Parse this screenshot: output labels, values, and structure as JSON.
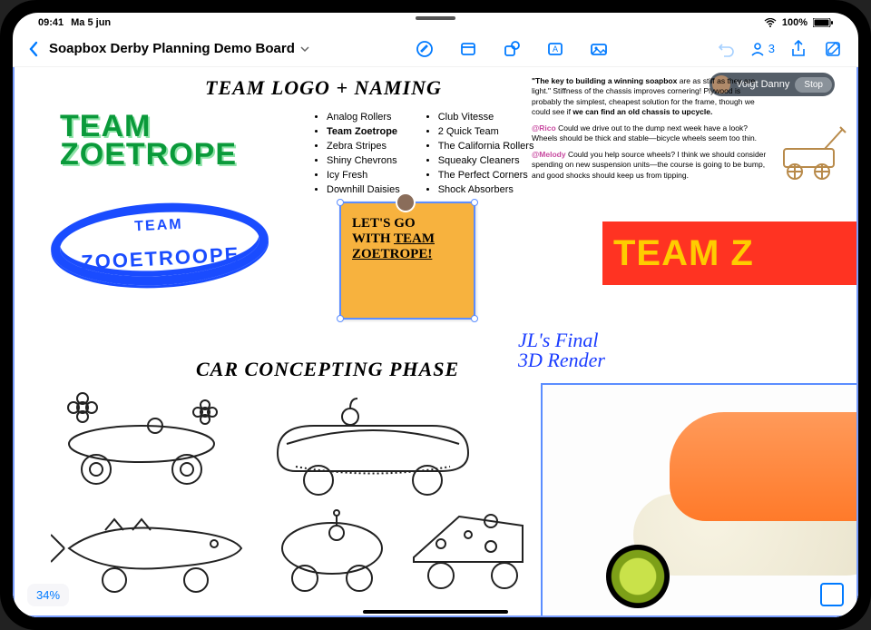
{
  "status": {
    "time": "09:41",
    "date": "Ma 5 jun",
    "battery": "100%"
  },
  "toolbar": {
    "title": "Soapbox Derby Planning Demo Board",
    "collab_count": "3"
  },
  "canvas": {
    "heading_logo": "TEAM LOGO + NAMING",
    "heading_concept": "CAR CONCEPTING PHASE",
    "logo1_line1": "TEAM",
    "logo1_line2": "ZOETROPE",
    "ring_line1": "TEAM",
    "ring_line2": "ZOOETROOPE",
    "names_col1": [
      "Analog Rollers",
      "Team Zoetrope",
      "Zebra Stripes",
      "Shiny Chevrons",
      "Icy Fresh",
      "Downhill Daisies"
    ],
    "names_col2": [
      "Club Vitesse",
      "2 Quick Team",
      "The California Rollers",
      "Squeaky Cleaners",
      "The Perfect Corners",
      "Shock Absorbers"
    ],
    "sticky_line1": "LET'S GO",
    "sticky_line2": "WITH",
    "sticky_line3": "TEAM",
    "sticky_line4": "ZOETROPE!",
    "quote_main1": "\"The key to building a winning soapbox",
    "quote_main2": "are as stiff as they are light.\" Stiffness of the chassis improves cornering! Plywood is probably the simplest, cheapest solution for the frame, though we could see if ",
    "quote_bold": "we can find an old chassis to upcycle.",
    "quote_rico_name": "@Rico",
    "quote_rico": " Could we drive out to the dump next week have a look? Wheels should be thick and stable—bicycle wheels seem too thin.",
    "quote_melody_name": "@Melody",
    "quote_melody": " Could you help source wheels? I think we should consider spending on new suspension units—the course is going to be bump, and good shocks should keep us from tipping.",
    "banner": "TEAM Z",
    "render_note1": "JL's Final",
    "render_note2": "3D Render",
    "follow_label": "Volgt Danny",
    "follow_stop": "Stop",
    "zoom": "34%"
  }
}
